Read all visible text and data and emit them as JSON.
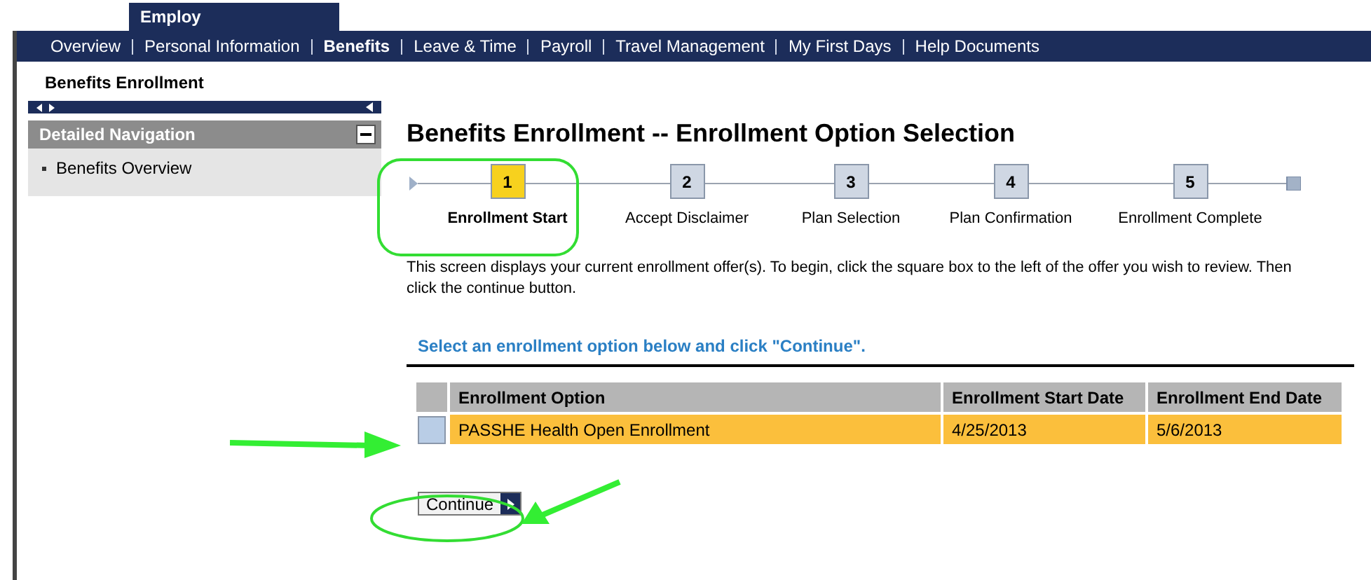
{
  "top_tab": {
    "label": "Employ"
  },
  "nav": [
    {
      "label": "Overview",
      "selected": false
    },
    {
      "label": "Personal Information",
      "selected": false
    },
    {
      "label": "Benefits",
      "selected": true
    },
    {
      "label": "Leave & Time",
      "selected": false
    },
    {
      "label": "Payroll",
      "selected": false
    },
    {
      "label": "Travel Management",
      "selected": false
    },
    {
      "label": "My First Days",
      "selected": false
    },
    {
      "label": "Help Documents",
      "selected": false
    }
  ],
  "breadcrumb": "Benefits Enrollment",
  "sidebar": {
    "header": "Detailed Navigation",
    "items": [
      "Benefits Overview"
    ]
  },
  "title": "Benefits Enrollment -- Enrollment Option Selection",
  "steps": [
    {
      "number": "1",
      "label": "Enrollment Start",
      "selected": true
    },
    {
      "number": "2",
      "label": "Accept Disclaimer",
      "selected": false
    },
    {
      "number": "3",
      "label": "Plan Selection",
      "selected": false
    },
    {
      "number": "4",
      "label": "Plan Confirmation",
      "selected": false
    },
    {
      "number": "5",
      "label": "Enrollment Complete",
      "selected": false
    }
  ],
  "intro": "This screen displays your current enrollment offer(s).  To begin, click the square box to the left of the offer you wish to review.  Then click the continue button.",
  "section_heading": "Select an enrollment option below and click \"Continue\".",
  "table": {
    "columns": [
      "Enrollment Option",
      "Enrollment Start Date",
      "Enrollment End Date"
    ],
    "rows": [
      {
        "selected": true,
        "cells": [
          "PASSHE Health Open Enrollment",
          "4/25/2013",
          "5/6/2013"
        ]
      }
    ]
  },
  "continue_button": "Continue"
}
